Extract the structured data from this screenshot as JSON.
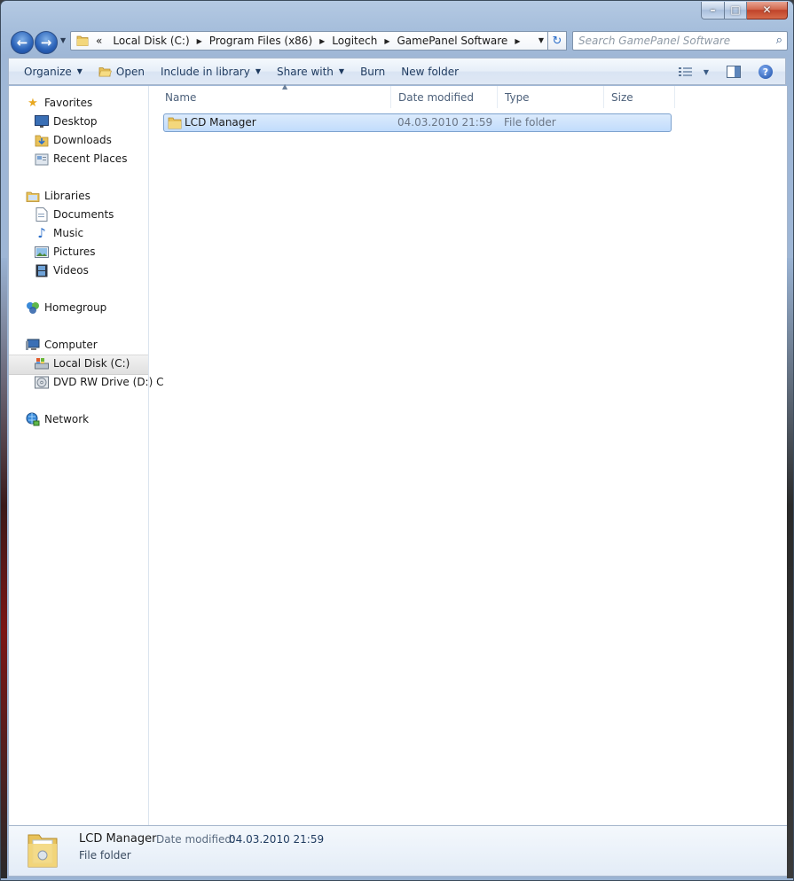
{
  "window": {
    "caption": {
      "min": "–",
      "max": "□",
      "close": "✕"
    }
  },
  "nav": {
    "back_icon": "back-arrow-icon",
    "forward_icon": "forward-arrow-icon",
    "overflow": "«",
    "breadcrumbs": [
      "Local Disk (C:)",
      "Program Files (x86)",
      "Logitech",
      "GamePanel Software"
    ],
    "search_placeholder": "Search GamePanel Software"
  },
  "toolbar": {
    "organize": "Organize",
    "open": "Open",
    "include_in_library": "Include in library",
    "share_with": "Share with",
    "burn": "Burn",
    "new_folder": "New folder"
  },
  "sidebar": {
    "favorites": {
      "label": "Favorites",
      "items": [
        "Desktop",
        "Downloads",
        "Recent Places"
      ]
    },
    "libraries": {
      "label": "Libraries",
      "items": [
        "Documents",
        "Music",
        "Pictures",
        "Videos"
      ]
    },
    "homegroup": "Homegroup",
    "computer": {
      "label": "Computer",
      "items": [
        "Local Disk (C:)",
        "DVD RW Drive (D:) C"
      ]
    },
    "network": "Network",
    "selected": "Local Disk (C:)"
  },
  "columns": [
    "Name",
    "Date modified",
    "Type",
    "Size"
  ],
  "files": [
    {
      "name": "LCD Manager",
      "date_modified": "04.03.2010 21:59",
      "type": "File folder",
      "size": ""
    }
  ],
  "details": {
    "name": "LCD Manager",
    "date_label": "Date modified:",
    "date_value": "04.03.2010 21:59",
    "type": "File folder"
  },
  "colors": {
    "selection": "#c1dcfc",
    "selection_border": "#7da2ce",
    "toolbar_text": "#1e3a5f"
  }
}
